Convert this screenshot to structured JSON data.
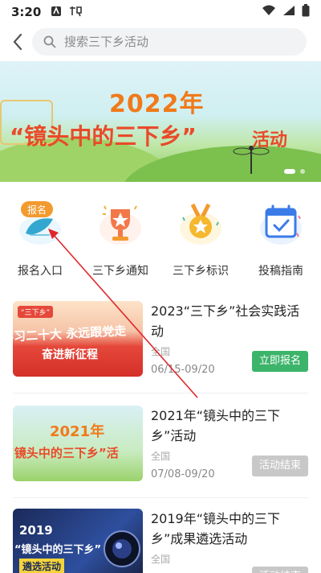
{
  "status_bar": {
    "time": "3:20"
  },
  "search": {
    "placeholder": "搜索三下乡活动"
  },
  "banner": {
    "year": "2022年",
    "title": "“镜头中的三下乡”",
    "subtitle": "活动"
  },
  "menu": [
    {
      "label": "报名入口",
      "badge": "报名",
      "icon": "signup-icon"
    },
    {
      "label": "三下乡通知",
      "icon": "trophy-icon"
    },
    {
      "label": "三下乡标识",
      "icon": "medal-icon"
    },
    {
      "label": "投稿指南",
      "icon": "calendar-check-icon"
    }
  ],
  "activities": [
    {
      "title": "2023“三下乡”社会实践活动",
      "region": "全国",
      "dates": "06/15-09/20",
      "action": "立即报名",
      "thumb_tag": "“三下乡”",
      "thumb_line1": "学习二十大 永远跟党走",
      "thumb_line2": "奋进新征程"
    },
    {
      "title": "2021年“镜头中的三下乡”活动",
      "region": "全国",
      "dates": "07/08-09/20",
      "action": "活动结束",
      "thumb_line1": "2021年",
      "thumb_line2": "“镜头中的三下乡”活"
    },
    {
      "title": "2019年“镜头中的三下乡”成果遴选活动",
      "region": "全国",
      "dates": "",
      "action": "活动结束",
      "thumb_line1": "2019",
      "thumb_line2": "“镜头中的三下乡”",
      "thumb_line3": "遴选活动"
    }
  ],
  "colors": {
    "accent_green": "#3cb46a",
    "ended_gray": "#c8c8c8",
    "banner_orange": "#f07a1a",
    "banner_red": "#e94a2a",
    "annotation_red": "#e0262b"
  }
}
